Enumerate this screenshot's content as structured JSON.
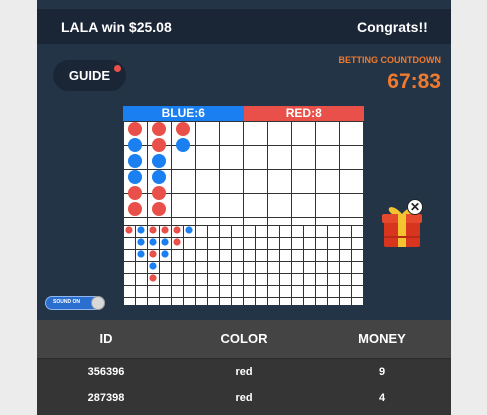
{
  "ticker": {
    "left_text": "LALA win $25.08",
    "right_text": "Congrats!!"
  },
  "guide": {
    "label": "GUIDE"
  },
  "countdown": {
    "label": "BETTING COUNTDOWN",
    "value": "67:83"
  },
  "board": {
    "blue_label": "BLUE:6",
    "red_label": "RED:8",
    "colors": {
      "blue": "#1a7ff0",
      "red": "#e9504a"
    },
    "big_road": [
      [
        "red",
        "blue",
        "blue",
        "blue",
        "red",
        "red"
      ],
      [
        "red",
        "red",
        "blue",
        "blue",
        "red",
        "red"
      ],
      [
        "red",
        "blue"
      ]
    ],
    "small_road": [
      [
        "red"
      ],
      [
        "blue",
        "blue",
        "blue"
      ],
      [
        "red",
        "blue",
        "red",
        "blue",
        "red"
      ],
      [
        "red",
        "blue",
        "blue"
      ],
      [
        "red",
        "red"
      ],
      [
        "blue"
      ]
    ]
  },
  "sound": {
    "label": "SOUND ON",
    "state": "on"
  },
  "bets_table": {
    "headers": [
      "ID",
      "COLOR",
      "MONEY"
    ],
    "rows": [
      [
        "356396",
        "red",
        "9"
      ],
      [
        "287398",
        "red",
        "4"
      ]
    ]
  }
}
